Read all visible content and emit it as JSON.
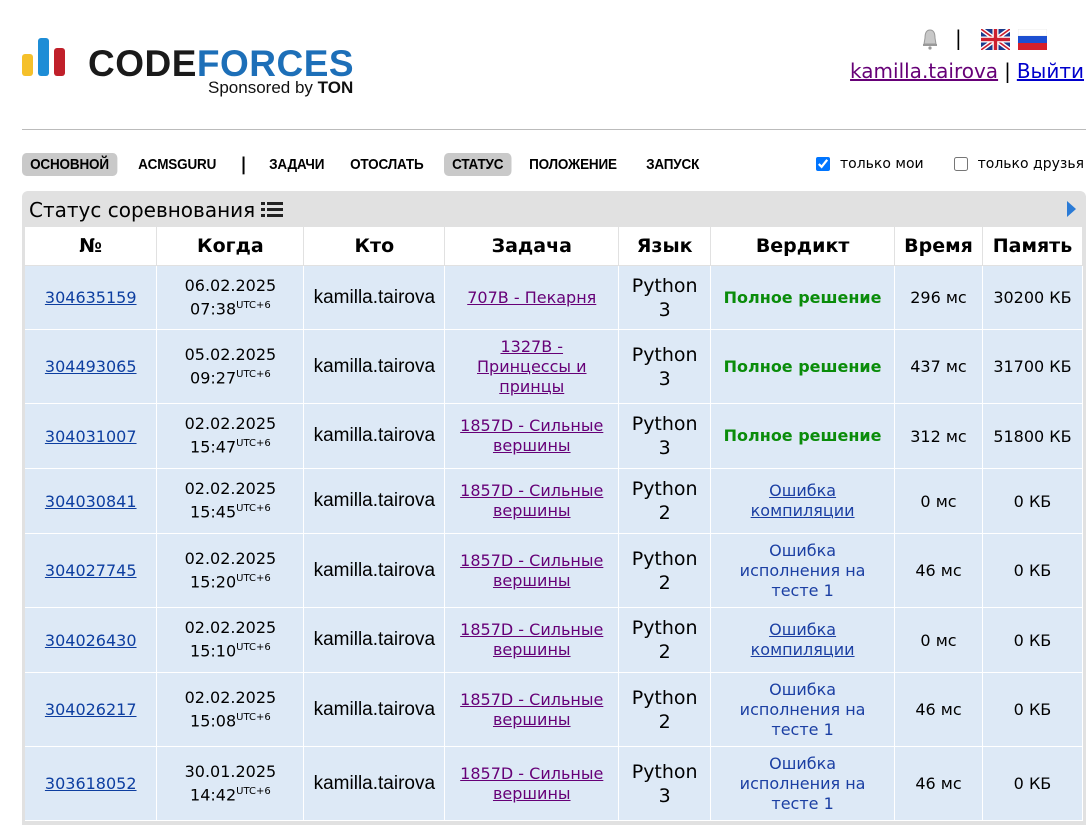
{
  "header": {
    "logo_part1": "CODE",
    "logo_part2": "FORCES",
    "sponsor_prefix": "Sponsored by ",
    "sponsor_name": "TON",
    "username": "kamilla.tairova",
    "logout": "Выйти",
    "separator": "|"
  },
  "nav": {
    "items": [
      {
        "label": "ОСНОВНОЙ",
        "active": true
      },
      {
        "label": "ACMSGURU",
        "active": false
      },
      {
        "label": "ЗАДАЧИ",
        "active": false
      },
      {
        "label": "ОТОСЛАТЬ",
        "active": false
      },
      {
        "label": "СТАТУС",
        "active": true
      },
      {
        "label": "ПОЛОЖЕНИЕ",
        "active": false
      },
      {
        "label": "ЗАПУСК",
        "active": false
      }
    ],
    "sep": "|",
    "filter_mine": "только мои",
    "filter_friends": "только друзья"
  },
  "panel": {
    "title": "Статус соревнования",
    "columns": [
      "№",
      "Когда",
      "Кто",
      "Задача",
      "Язык",
      "Вердикт",
      "Время",
      "Память"
    ],
    "rows": [
      {
        "id": "304635159",
        "date": "06.02.2025",
        "time": "07:38",
        "tz": "UTC+6",
        "who": "kamilla.tairova",
        "problem": "707B - Пекарня",
        "lang1": "Python",
        "lang2": "3",
        "verdict": "Полное решение",
        "vtype": "ok",
        "tm": "296 мс",
        "mem": "30200 КБ"
      },
      {
        "id": "304493065",
        "date": "05.02.2025",
        "time": "09:27",
        "tz": "UTC+6",
        "who": "kamilla.tairova",
        "problem": "1327B - Принцессы и принцы",
        "lang1": "Python",
        "lang2": "3",
        "verdict": "Полное решение",
        "vtype": "ok",
        "tm": "437 мс",
        "mem": "31700 КБ"
      },
      {
        "id": "304031007",
        "date": "02.02.2025",
        "time": "15:47",
        "tz": "UTC+6",
        "who": "kamilla.tairova",
        "problem": "1857D - Сильные вершины",
        "lang1": "Python",
        "lang2": "3",
        "verdict": "Полное решение",
        "vtype": "ok",
        "tm": "312 мс",
        "mem": "51800 КБ"
      },
      {
        "id": "304030841",
        "date": "02.02.2025",
        "time": "15:45",
        "tz": "UTC+6",
        "who": "kamilla.tairova",
        "problem": "1857D - Сильные вершины",
        "lang1": "Python",
        "lang2": "2",
        "verdict": "Ошибка компиляции",
        "vtype": "ce",
        "tm": "0 мс",
        "mem": "0 КБ"
      },
      {
        "id": "304027745",
        "date": "02.02.2025",
        "time": "15:20",
        "tz": "UTC+6",
        "who": "kamilla.tairova",
        "problem": "1857D - Сильные вершины",
        "lang1": "Python",
        "lang2": "2",
        "verdict": "Ошибка исполнения на тесте 1",
        "vtype": "re",
        "tm": "46 мс",
        "mem": "0 КБ"
      },
      {
        "id": "304026430",
        "date": "02.02.2025",
        "time": "15:10",
        "tz": "UTC+6",
        "who": "kamilla.tairova",
        "problem": "1857D - Сильные вершины",
        "lang1": "Python",
        "lang2": "2",
        "verdict": "Ошибка компиляции",
        "vtype": "ce",
        "tm": "0 мс",
        "mem": "0 КБ"
      },
      {
        "id": "304026217",
        "date": "02.02.2025",
        "time": "15:08",
        "tz": "UTC+6",
        "who": "kamilla.tairova",
        "problem": "1857D - Сильные вершины",
        "lang1": "Python",
        "lang2": "2",
        "verdict": "Ошибка исполнения на тесте 1",
        "vtype": "re",
        "tm": "46 мс",
        "mem": "0 КБ"
      },
      {
        "id": "303618052",
        "date": "30.01.2025",
        "time": "14:42",
        "tz": "UTC+6",
        "who": "kamilla.tairova",
        "problem": "1857D - Сильные вершины",
        "lang1": "Python",
        "lang2": "3",
        "verdict": "Ошибка исполнения на тесте 1",
        "vtype": "re",
        "tm": "46 мс",
        "mem": "0 КБ"
      }
    ]
  },
  "colors": {
    "accepted": "#0a8c0a",
    "verdict_link": "#1b3fa3",
    "row_bg": "#dde9f6",
    "brand_blue": "#1d6fb8"
  }
}
